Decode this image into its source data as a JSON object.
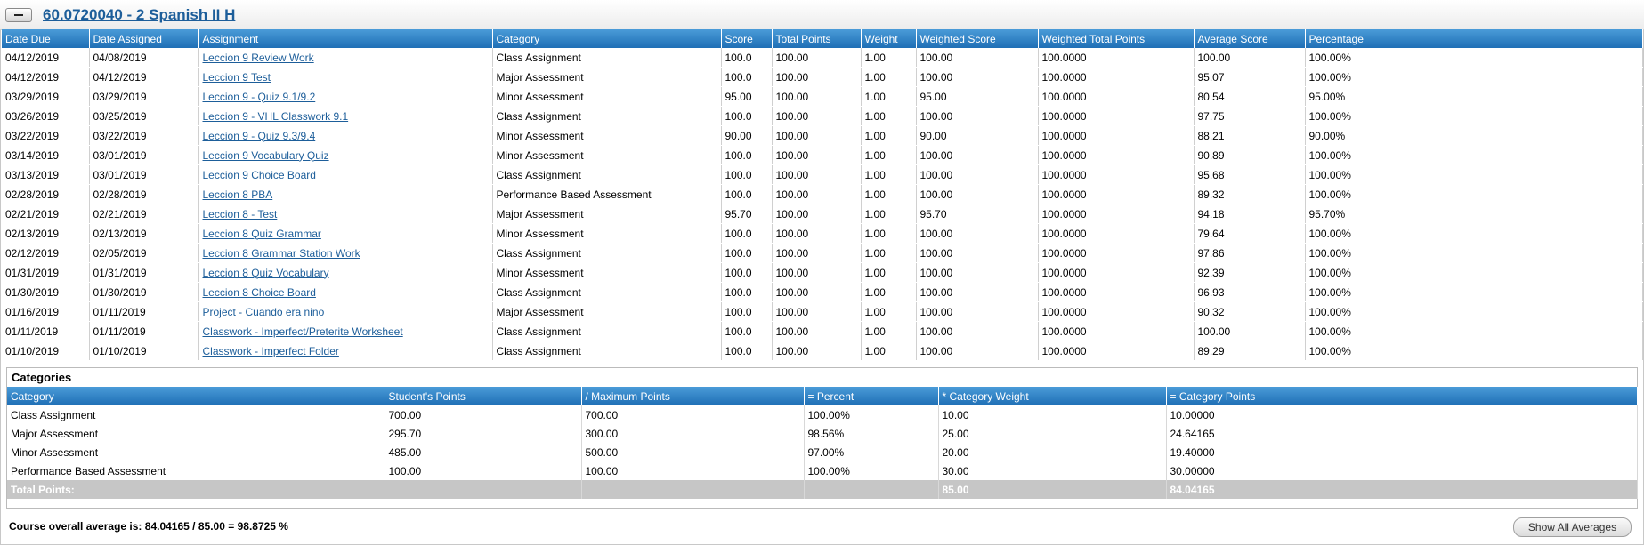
{
  "course": {
    "title": "60.0720040 - 2 Spanish II H"
  },
  "grades": {
    "columns": [
      "Date Due",
      "Date Assigned",
      "Assignment",
      "Category",
      "Score",
      "Total Points",
      "Weight",
      "Weighted Score",
      "Weighted Total Points",
      "Average Score",
      "Percentage"
    ],
    "rows": [
      [
        "04/12/2019",
        "04/08/2019",
        "Leccion 9 Review Work",
        "Class Assignment",
        "100.0",
        "100.00",
        "1.00",
        "100.00",
        "100.0000",
        "100.00",
        "100.00%"
      ],
      [
        "04/12/2019",
        "04/12/2019",
        "Leccion 9 Test",
        "Major Assessment",
        "100.0",
        "100.00",
        "1.00",
        "100.00",
        "100.0000",
        "95.07",
        "100.00%"
      ],
      [
        "03/29/2019",
        "03/29/2019",
        "Leccion 9 - Quiz 9.1/9.2",
        "Minor Assessment",
        "95.00",
        "100.00",
        "1.00",
        "95.00",
        "100.0000",
        "80.54",
        "95.00%"
      ],
      [
        "03/26/2019",
        "03/25/2019",
        "Leccion 9 - VHL Classwork 9.1",
        "Class Assignment",
        "100.0",
        "100.00",
        "1.00",
        "100.00",
        "100.0000",
        "97.75",
        "100.00%"
      ],
      [
        "03/22/2019",
        "03/22/2019",
        "Leccion 9 - Quiz 9.3/9.4",
        "Minor Assessment",
        "90.00",
        "100.00",
        "1.00",
        "90.00",
        "100.0000",
        "88.21",
        "90.00%"
      ],
      [
        "03/14/2019",
        "03/01/2019",
        "Leccion 9 Vocabulary Quiz",
        "Minor Assessment",
        "100.0",
        "100.00",
        "1.00",
        "100.00",
        "100.0000",
        "90.89",
        "100.00%"
      ],
      [
        "03/13/2019",
        "03/01/2019",
        "Leccion 9 Choice Board",
        "Class Assignment",
        "100.0",
        "100.00",
        "1.00",
        "100.00",
        "100.0000",
        "95.68",
        "100.00%"
      ],
      [
        "02/28/2019",
        "02/28/2019",
        "Leccion 8 PBA",
        "Performance Based Assessment",
        "100.0",
        "100.00",
        "1.00",
        "100.00",
        "100.0000",
        "89.32",
        "100.00%"
      ],
      [
        "02/21/2019",
        "02/21/2019",
        "Leccion 8 - Test",
        "Major Assessment",
        "95.70",
        "100.00",
        "1.00",
        "95.70",
        "100.0000",
        "94.18",
        "95.70%"
      ],
      [
        "02/13/2019",
        "02/13/2019",
        "Leccion 8 Quiz Grammar",
        "Minor Assessment",
        "100.0",
        "100.00",
        "1.00",
        "100.00",
        "100.0000",
        "79.64",
        "100.00%"
      ],
      [
        "02/12/2019",
        "02/05/2019",
        "Leccion 8 Grammar Station Work",
        "Class Assignment",
        "100.0",
        "100.00",
        "1.00",
        "100.00",
        "100.0000",
        "97.86",
        "100.00%"
      ],
      [
        "01/31/2019",
        "01/31/2019",
        "Leccion 8 Quiz Vocabulary",
        "Minor Assessment",
        "100.0",
        "100.00",
        "1.00",
        "100.00",
        "100.0000",
        "92.39",
        "100.00%"
      ],
      [
        "01/30/2019",
        "01/30/2019",
        "Leccion 8 Choice Board",
        "Class Assignment",
        "100.0",
        "100.00",
        "1.00",
        "100.00",
        "100.0000",
        "96.93",
        "100.00%"
      ],
      [
        "01/16/2019",
        "01/11/2019",
        "Project - Cuando era nino",
        "Major Assessment",
        "100.0",
        "100.00",
        "1.00",
        "100.00",
        "100.0000",
        "90.32",
        "100.00%"
      ],
      [
        "01/11/2019",
        "01/11/2019",
        "Classwork - Imperfect/Preterite Worksheet",
        "Class Assignment",
        "100.0",
        "100.00",
        "1.00",
        "100.00",
        "100.0000",
        "100.00",
        "100.00%"
      ],
      [
        "01/10/2019",
        "01/10/2019",
        "Classwork - Imperfect Folder",
        "Class Assignment",
        "100.0",
        "100.00",
        "1.00",
        "100.00",
        "100.0000",
        "89.29",
        "100.00%"
      ]
    ]
  },
  "categories": {
    "title": "Categories",
    "columns": [
      "Category",
      "Student's Points",
      "/ Maximum Points",
      "= Percent",
      "* Category Weight",
      "= Category Points"
    ],
    "rows": [
      [
        "Class Assignment",
        "700.00",
        "700.00",
        "100.00%",
        "10.00",
        "10.00000"
      ],
      [
        "Major Assessment",
        "295.70",
        "300.00",
        "98.56%",
        "25.00",
        "24.64165"
      ],
      [
        "Minor Assessment",
        "485.00",
        "500.00",
        "97.00%",
        "20.00",
        "19.40000"
      ],
      [
        "Performance Based Assessment",
        "100.00",
        "100.00",
        "100.00%",
        "30.00",
        "30.00000"
      ]
    ],
    "total": [
      "Total Points:",
      "",
      "",
      "",
      "85.00",
      "84.04165"
    ]
  },
  "summary": {
    "label": "Course overall average is:",
    "points": "84.04165",
    "max": "85.00",
    "percent": "98.8725 %"
  },
  "show_all_label": "Show All Averages"
}
